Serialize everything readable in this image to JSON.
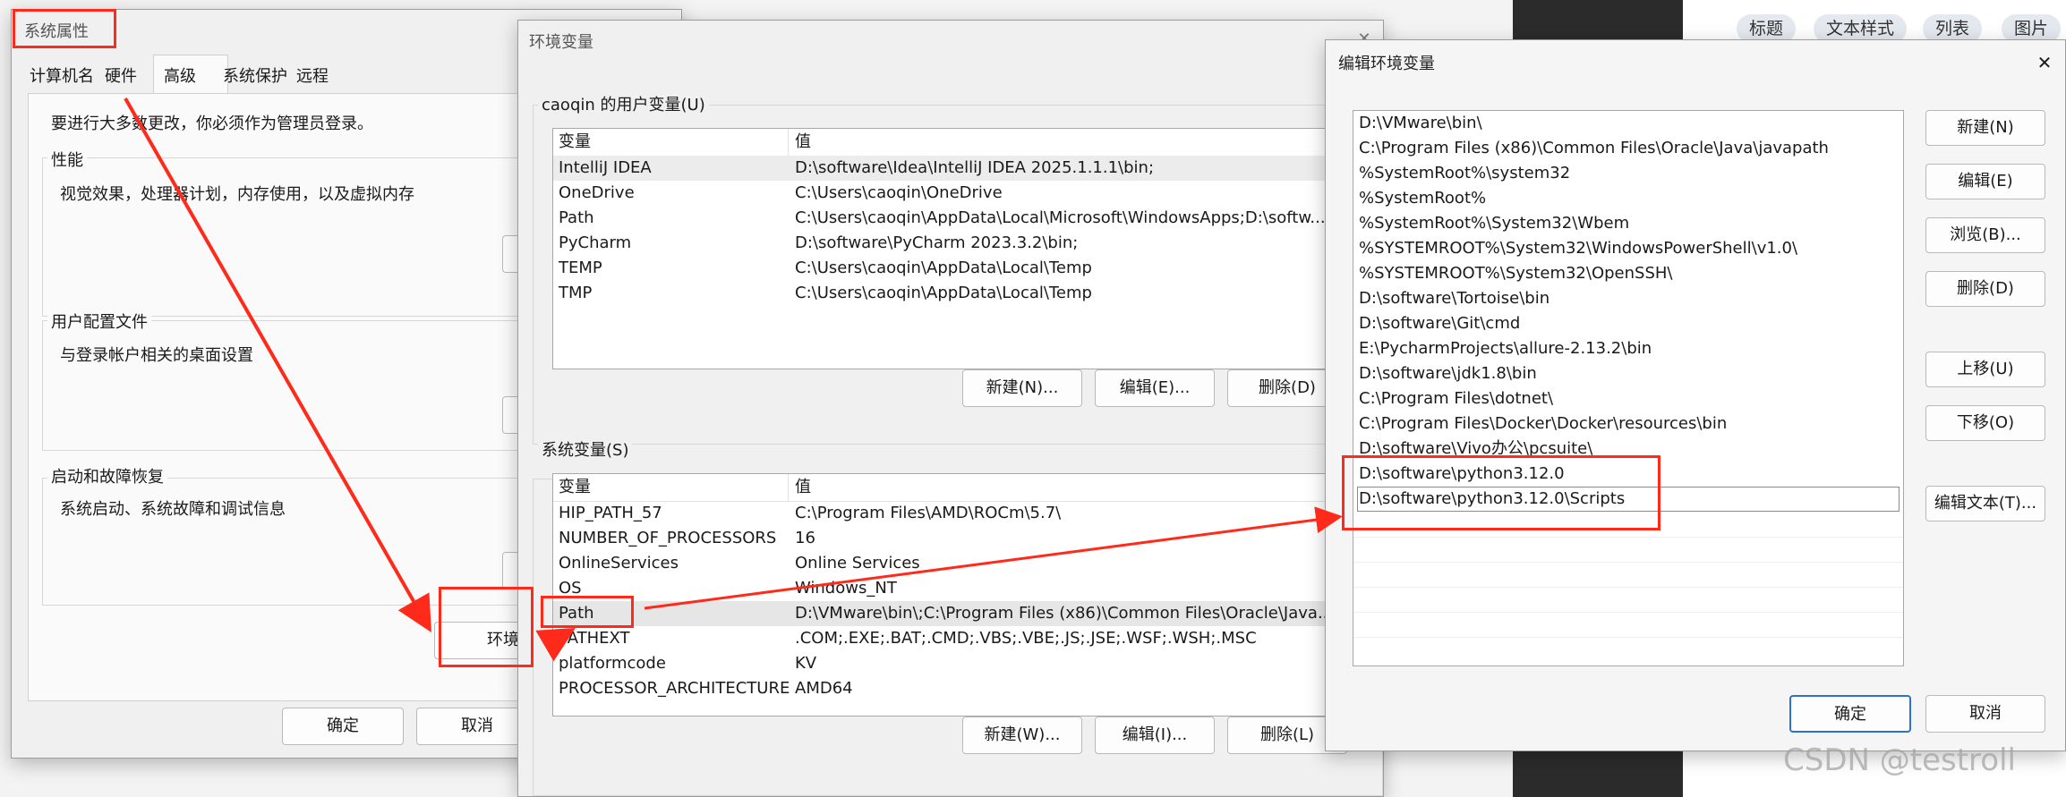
{
  "sys_props": {
    "title": "系统属性",
    "tabs": [
      "计算机名",
      "硬件",
      "高级",
      "系统保护",
      "远程"
    ],
    "admin_note": "要进行大多数更改，你必须作为管理员登录。",
    "perf_label": "性能",
    "perf_desc": "视觉效果，处理器计划，内存使用，以及虚拟内存",
    "profile_label": "用户配置文件",
    "profile_desc": "与登录帐户相关的桌面设置",
    "startup_label": "启动和故障恢复",
    "startup_desc": "系统启动、系统故障和调试信息",
    "env_btn": "环境",
    "ok": "确定",
    "cancel": "取消"
  },
  "env_vars": {
    "title": "环境变量",
    "user_group": "caoqin 的用户变量(U)",
    "col_var": "变量",
    "col_val": "值",
    "user_rows": [
      {
        "name": "IntelliJ IDEA",
        "value": "D:\\software\\Idea\\IntelliJ IDEA 2025.1.1.1\\bin;"
      },
      {
        "name": "OneDrive",
        "value": "C:\\Users\\caoqin\\OneDrive"
      },
      {
        "name": "Path",
        "value": "C:\\Users\\caoqin\\AppData\\Local\\Microsoft\\WindowsApps;D:\\softw..."
      },
      {
        "name": "PyCharm",
        "value": "D:\\software\\PyCharm 2023.3.2\\bin;"
      },
      {
        "name": "TEMP",
        "value": "C:\\Users\\caoqin\\AppData\\Local\\Temp"
      },
      {
        "name": "TMP",
        "value": "C:\\Users\\caoqin\\AppData\\Local\\Temp"
      }
    ],
    "user_new": "新建(N)...",
    "user_edit": "编辑(E)...",
    "user_delete": "删除(D)",
    "sys_group": "系统变量(S)",
    "sys_rows": [
      {
        "name": "HIP_PATH_57",
        "value": "C:\\Program Files\\AMD\\ROCm\\5.7\\"
      },
      {
        "name": "NUMBER_OF_PROCESSORS",
        "value": "16"
      },
      {
        "name": "OnlineServices",
        "value": "Online Services"
      },
      {
        "name": "OS",
        "value": "Windows_NT"
      },
      {
        "name": "Path",
        "value": "D:\\VMware\\bin\\;C:\\Program Files (x86)\\Common Files\\Oracle\\Java..."
      },
      {
        "name": "PATHEXT",
        "value": ".COM;.EXE;.BAT;.CMD;.VBS;.VBE;.JS;.JSE;.WSF;.WSH;.MSC"
      },
      {
        "name": "platformcode",
        "value": "KV"
      },
      {
        "name": "PROCESSOR_ARCHITECTURE",
        "value": "AMD64"
      }
    ],
    "sys_new": "新建(W)...",
    "sys_edit": "编辑(I)...",
    "sys_delete": "删除(L)"
  },
  "edit_env": {
    "title": "编辑环境变量",
    "close": "✕",
    "paths": [
      "D:\\VMware\\bin\\",
      "C:\\Program Files (x86)\\Common Files\\Oracle\\Java\\javapath",
      "%SystemRoot%\\system32",
      "%SystemRoot%",
      "%SystemRoot%\\System32\\Wbem",
      "%SYSTEMROOT%\\System32\\WindowsPowerShell\\v1.0\\",
      "%SYSTEMROOT%\\System32\\OpenSSH\\",
      "D:\\software\\Tortoise\\bin",
      "D:\\software\\Git\\cmd",
      "E:\\PycharmProjects\\allure-2.13.2\\bin",
      "D:\\software\\jdk1.8\\bin",
      "C:\\Program Files\\dotnet\\",
      "C:\\Program Files\\Docker\\Docker\\resources\\bin",
      "D:\\software\\Vivo办公\\pcsuite\\",
      "D:\\software\\python3.12.0",
      "D:\\software\\python3.12.0\\Scripts"
    ],
    "btn_new": "新建(N)",
    "btn_edit": "编辑(E)",
    "btn_browse": "浏览(B)...",
    "btn_delete": "删除(D)",
    "btn_up": "上移(U)",
    "btn_down": "下移(O)",
    "btn_edit_text": "编辑文本(T)...",
    "ok": "确定",
    "cancel": "取消"
  },
  "bg_toolbar": [
    "标题",
    "文本样式",
    "列表",
    "图片"
  ],
  "watermark": "CSDN @testroll",
  "colors": {
    "highlight": "#ff2a1a",
    "accent": "#2f6fd1"
  }
}
